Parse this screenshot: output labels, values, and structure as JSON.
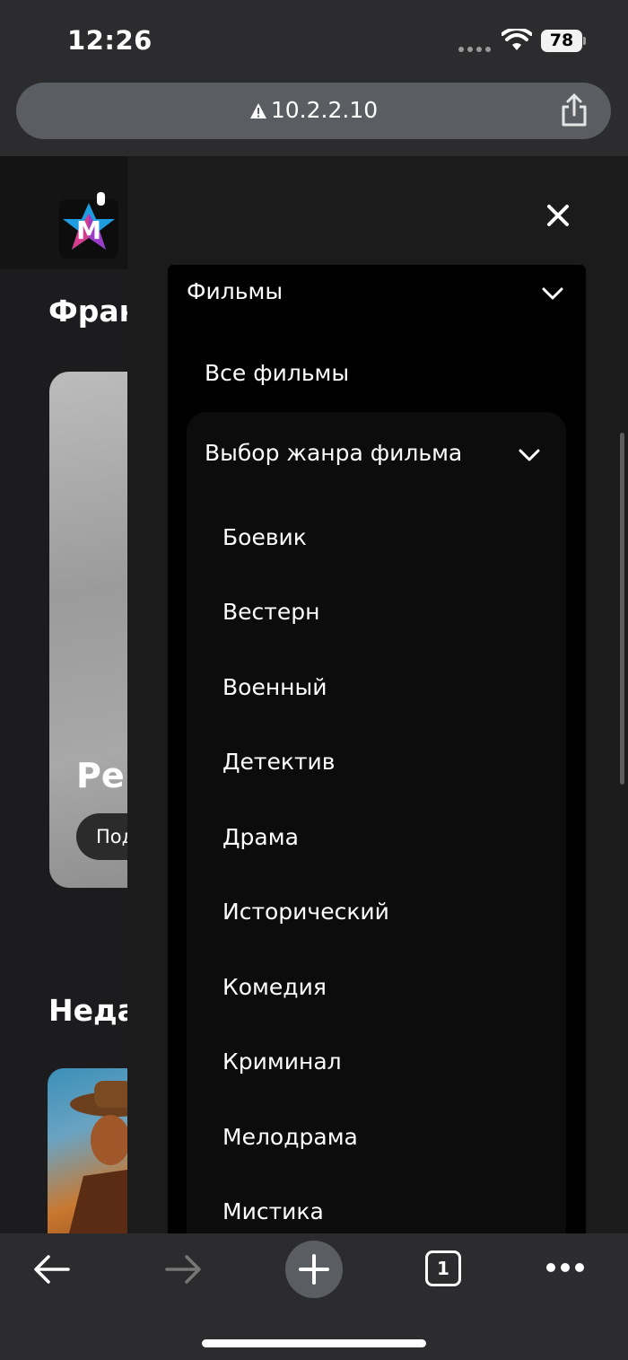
{
  "status_bar": {
    "time": "12:26",
    "battery": "78"
  },
  "browser": {
    "url": "10.2.2.10",
    "tab_count": "1"
  },
  "page": {
    "section_1_title": "Фран",
    "promo_title": "Ре",
    "promo_button": "Под",
    "section_2_title": "Неда"
  },
  "menu": {
    "films_label": "Фильмы",
    "all_films_label": "Все фильмы",
    "genre_select_label": "Выбор жанра фильма",
    "genres": [
      "Боевик",
      "Вестерн",
      "Военный",
      "Детектив",
      "Драма",
      "Исторический",
      "Комедия",
      "Криминал",
      "Мелодрама",
      "Мистика"
    ]
  },
  "icons": {
    "warning": "warning-icon",
    "share": "share-icon",
    "close": "close-icon",
    "back": "back-arrow-icon",
    "forward": "forward-arrow-icon",
    "new_tab": "plus-icon",
    "more": "more-icon"
  }
}
